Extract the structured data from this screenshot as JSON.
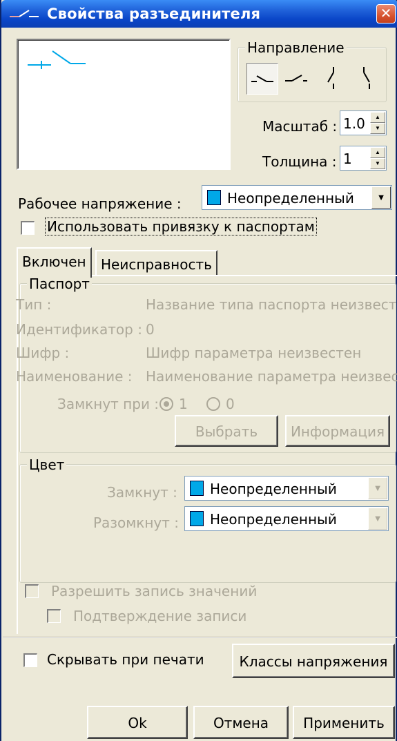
{
  "window": {
    "title": "Свойства разъединителя",
    "close_glyph": "✕"
  },
  "direction": {
    "label": "Направление",
    "options": [
      "horizontal-right",
      "horizontal-left",
      "vertical-up",
      "vertical-down"
    ],
    "selected_index": 0
  },
  "scale": {
    "label": "Масштаб :",
    "value": "1.0"
  },
  "thickness": {
    "label": "Толщина :",
    "value": "1"
  },
  "voltage": {
    "label": "Рабочее напряжение :",
    "value": "Неопределенный",
    "swatch_color": "#00a8e8"
  },
  "passport_binding": {
    "label": "Использовать привязку к паспортам",
    "checked": false
  },
  "tabs": [
    {
      "label": "Включен",
      "active": true
    },
    {
      "label": "Неисправность",
      "active": false
    }
  ],
  "passport": {
    "title": "Паспорт",
    "rows": [
      {
        "key": "Тип :",
        "value": "Название типа паспорта неизвестн"
      },
      {
        "key": "Идентификатор :",
        "value": "0"
      },
      {
        "key": "Шифр :",
        "value": "Шифр параметра неизвестен"
      },
      {
        "key": "Наименование :",
        "value": "Наименование параметра неизвес"
      }
    ],
    "closed_at_label": "Замкнут при :",
    "closed_at_options": [
      "1",
      "0"
    ],
    "closed_at_selected": "1",
    "select_button": "Выбрать",
    "info_button": "Информация"
  },
  "color": {
    "title": "Цвет",
    "closed_label": "Замкнут :",
    "closed_value": "Неопределенный",
    "open_label": "Разомкнут :",
    "open_value": "Неопределенный",
    "swatch_color": "#00a8e8"
  },
  "allow_write": {
    "label": "Разрешить запись значений",
    "checked": false
  },
  "confirm_write": {
    "label": "Подтверждение записи",
    "checked": false
  },
  "hide_on_print": {
    "label": "Скрывать при печати",
    "checked": false
  },
  "voltage_classes_button": "Классы напряжения",
  "footer": {
    "ok": "Ok",
    "cancel": "Отмена",
    "apply": "Применить"
  }
}
